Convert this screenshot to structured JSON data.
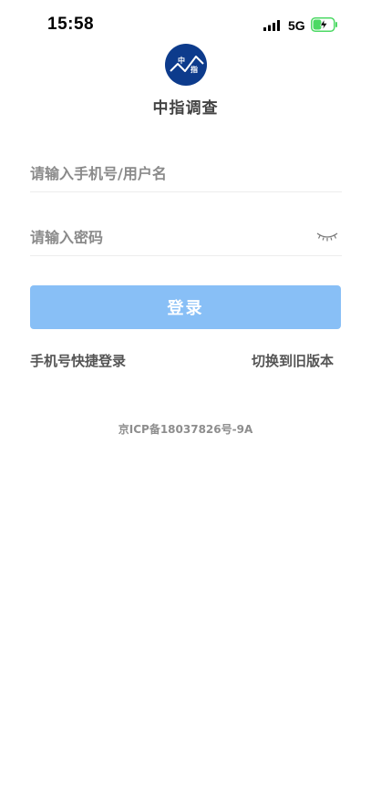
{
  "status_bar": {
    "time": "15:58",
    "network": "5G",
    "signal_icon": "signal-bars-icon",
    "battery_icon": "battery-charging-icon",
    "battery_color": "#4cd964"
  },
  "app": {
    "name": "中指调查",
    "logo_icon": "zhongzhi-logo-icon",
    "logo_text_top": "中",
    "logo_text_bottom": "指",
    "brand_color": "#0d3b8c"
  },
  "form": {
    "username_placeholder": "请输入手机号/用户名",
    "username_value": "",
    "password_placeholder": "请输入密码",
    "password_value": "",
    "password_toggle_icon": "eye-closed-icon",
    "login_label": "登录",
    "login_color": "#88bff6"
  },
  "links": {
    "quick_login": "手机号快捷登录",
    "switch_version": "切换到旧版本"
  },
  "footer": {
    "icp": "京ICP备18037826号-9A"
  }
}
